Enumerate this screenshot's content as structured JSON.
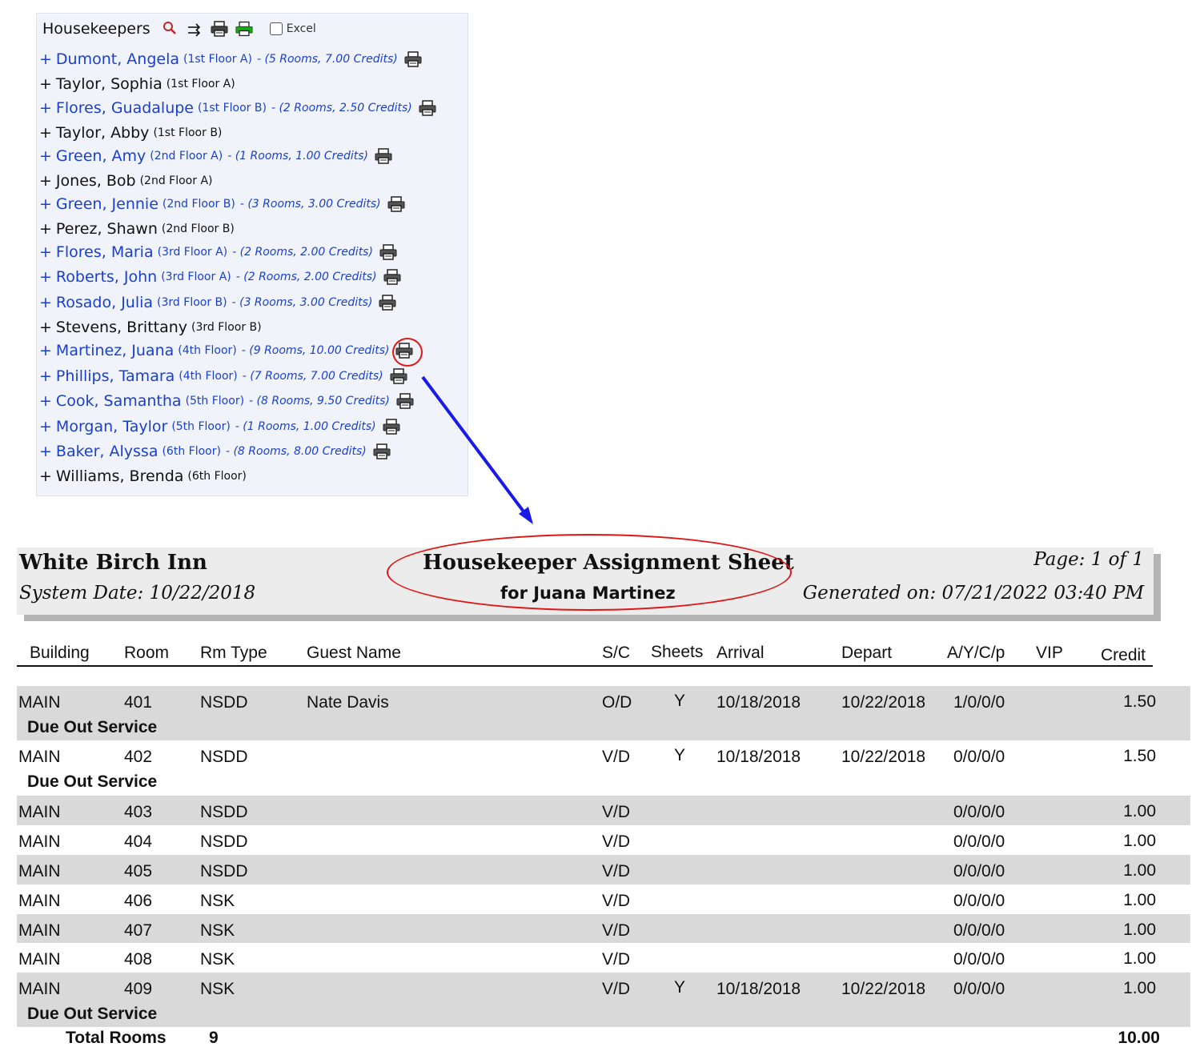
{
  "panel": {
    "title": "Housekeepers",
    "excel_label": "Excel",
    "icons": [
      "search-icon",
      "swap-arrows-icon",
      "printer-icon",
      "green-printer-icon"
    ],
    "housekeepers": [
      {
        "name": "Dumont, Angela",
        "floor": "(1st Floor A)",
        "credits": "- (5 Rooms, 7.00 Credits)",
        "active": true
      },
      {
        "name": "Taylor, Sophia",
        "floor": "(1st Floor A)",
        "credits": "",
        "active": false
      },
      {
        "name": "Flores, Guadalupe",
        "floor": "(1st Floor B)",
        "credits": "- (2 Rooms, 2.50 Credits)",
        "active": true
      },
      {
        "name": "Taylor, Abby",
        "floor": "(1st Floor B)",
        "credits": "",
        "active": false
      },
      {
        "name": "Green, Amy",
        "floor": "(2nd Floor A)",
        "credits": "- (1 Rooms, 1.00 Credits)",
        "active": true
      },
      {
        "name": "Jones, Bob",
        "floor": "(2nd Floor A)",
        "credits": "",
        "active": false
      },
      {
        "name": "Green, Jennie",
        "floor": "(2nd Floor B)",
        "credits": "- (3 Rooms, 3.00 Credits)",
        "active": true
      },
      {
        "name": "Perez, Shawn",
        "floor": "(2nd Floor B)",
        "credits": "",
        "active": false
      },
      {
        "name": "Flores, Maria",
        "floor": "(3rd Floor A)",
        "credits": "- (2 Rooms, 2.00 Credits)",
        "active": true
      },
      {
        "name": "Roberts, John",
        "floor": "(3rd Floor A)",
        "credits": "- (2 Rooms, 2.00 Credits)",
        "active": true
      },
      {
        "name": "Rosado, Julia",
        "floor": "(3rd Floor B)",
        "credits": "- (3 Rooms, 3.00 Credits)",
        "active": true
      },
      {
        "name": "Stevens, Brittany",
        "floor": "(3rd Floor B)",
        "credits": "",
        "active": false
      },
      {
        "name": "Martinez, Juana",
        "floor": "(4th Floor)",
        "credits": "- (9 Rooms, 10.00 Credits)",
        "active": true,
        "highlight": true
      },
      {
        "name": "Phillips, Tamara",
        "floor": "(4th Floor)",
        "credits": "- (7 Rooms, 7.00 Credits)",
        "active": true
      },
      {
        "name": "Cook, Samantha",
        "floor": "(5th Floor)",
        "credits": "- (8 Rooms, 9.50 Credits)",
        "active": true
      },
      {
        "name": "Morgan, Taylor",
        "floor": "(5th Floor)",
        "credits": "- (1 Rooms, 1.00 Credits)",
        "active": true
      },
      {
        "name": "Baker, Alyssa",
        "floor": "(6th Floor)",
        "credits": "- (8 Rooms, 8.00 Credits)",
        "active": true
      },
      {
        "name": "Williams, Brenda",
        "floor": "(6th Floor)",
        "credits": "",
        "active": false
      }
    ]
  },
  "report": {
    "hotel_name": "White Birch Inn",
    "system_date": "System Date:  10/22/2018",
    "title": "Housekeeper Assignment Sheet",
    "subtitle": "for Juana Martinez",
    "page": "Page:  1 of 1",
    "generated_on": "Generated on:  07/21/2022 03:40 PM",
    "columns": [
      "Building",
      "Room",
      "Rm Type",
      "Guest Name",
      "S/C",
      "Sheets",
      "Arrival",
      "Depart",
      "A/Y/C/p",
      "VIP",
      "Credit"
    ],
    "rows": [
      {
        "building": "MAIN",
        "room": "401",
        "rm_type": "NSDD",
        "guest": "Nate Davis",
        "sc": "O/D",
        "sheets": "Y",
        "arrival": "10/18/2018",
        "depart": "10/22/2018",
        "aycp": "1/0/0/0",
        "vip": "",
        "credit": "1.50",
        "note": "Due Out Service"
      },
      {
        "building": "MAIN",
        "room": "402",
        "rm_type": "NSDD",
        "guest": "",
        "sc": "V/D",
        "sheets": "Y",
        "arrival": "10/18/2018",
        "depart": "10/22/2018",
        "aycp": "0/0/0/0",
        "vip": "",
        "credit": "1.50",
        "note": "Due Out Service"
      },
      {
        "building": "MAIN",
        "room": "403",
        "rm_type": "NSDD",
        "guest": "",
        "sc": "V/D",
        "sheets": "",
        "arrival": "",
        "depart": "",
        "aycp": "0/0/0/0",
        "vip": "",
        "credit": "1.00",
        "note": ""
      },
      {
        "building": "MAIN",
        "room": "404",
        "rm_type": "NSDD",
        "guest": "",
        "sc": "V/D",
        "sheets": "",
        "arrival": "",
        "depart": "",
        "aycp": "0/0/0/0",
        "vip": "",
        "credit": "1.00",
        "note": ""
      },
      {
        "building": "MAIN",
        "room": "405",
        "rm_type": "NSDD",
        "guest": "",
        "sc": "V/D",
        "sheets": "",
        "arrival": "",
        "depart": "",
        "aycp": "0/0/0/0",
        "vip": "",
        "credit": "1.00",
        "note": ""
      },
      {
        "building": "MAIN",
        "room": "406",
        "rm_type": "NSK",
        "guest": "",
        "sc": "V/D",
        "sheets": "",
        "arrival": "",
        "depart": "",
        "aycp": "0/0/0/0",
        "vip": "",
        "credit": "1.00",
        "note": ""
      },
      {
        "building": "MAIN",
        "room": "407",
        "rm_type": "NSK",
        "guest": "",
        "sc": "V/D",
        "sheets": "",
        "arrival": "",
        "depart": "",
        "aycp": "0/0/0/0",
        "vip": "",
        "credit": "1.00",
        "note": ""
      },
      {
        "building": "MAIN",
        "room": "408",
        "rm_type": "NSK",
        "guest": "",
        "sc": "V/D",
        "sheets": "",
        "arrival": "",
        "depart": "",
        "aycp": "0/0/0/0",
        "vip": "",
        "credit": "1.00",
        "note": ""
      },
      {
        "building": "MAIN",
        "room": "409",
        "rm_type": "NSK",
        "guest": "",
        "sc": "V/D",
        "sheets": "Y",
        "arrival": "10/18/2018",
        "depart": "10/22/2018",
        "aycp": "0/0/0/0",
        "vip": "",
        "credit": "1.00",
        "note": "Due Out Service"
      }
    ],
    "totals": {
      "label": "Total Rooms",
      "rooms": "9",
      "credits": "10.00"
    }
  },
  "colors": {
    "link": "#1a3fd0",
    "highlight": "#e01515",
    "arrow": "#1a1ae6",
    "shade": "#d9d9d9"
  }
}
